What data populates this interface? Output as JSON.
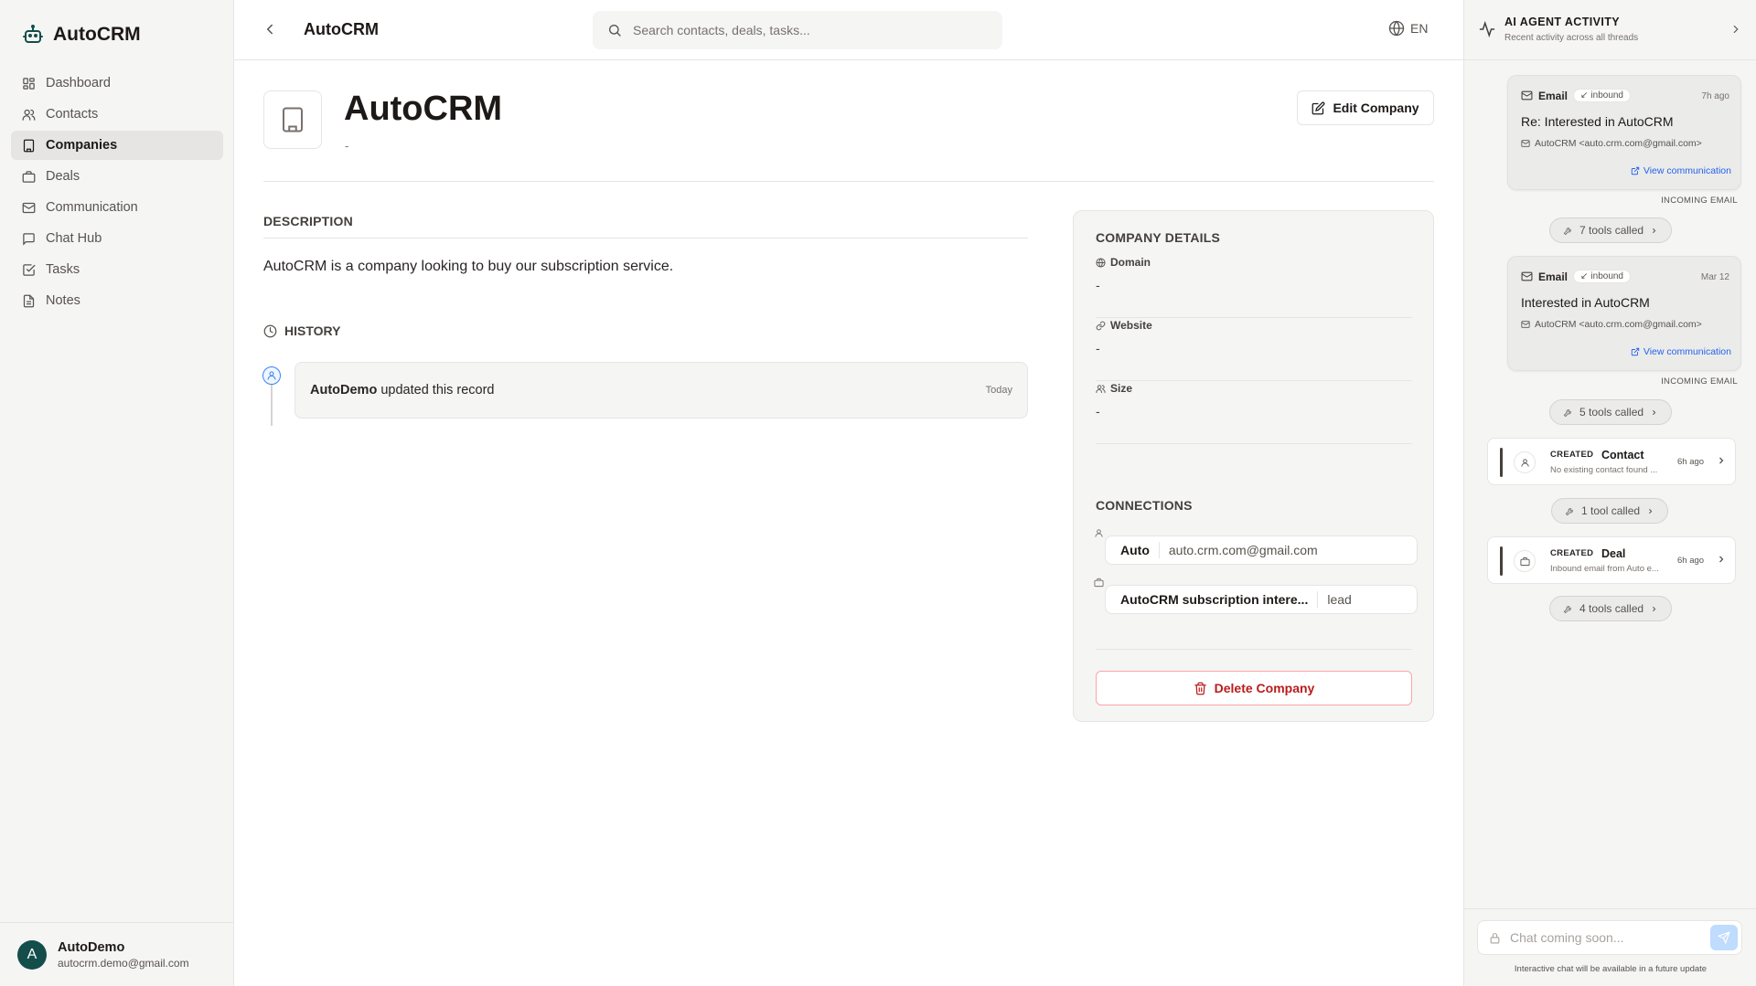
{
  "app": {
    "name": "AutoCRM"
  },
  "sidebar": {
    "items": [
      {
        "label": "Dashboard",
        "icon": "dashboard-icon"
      },
      {
        "label": "Contacts",
        "icon": "users-icon"
      },
      {
        "label": "Companies",
        "icon": "building-icon",
        "active": true
      },
      {
        "label": "Deals",
        "icon": "briefcase-icon"
      },
      {
        "label": "Communication",
        "icon": "mail-icon"
      },
      {
        "label": "Chat Hub",
        "icon": "chat-bubble-icon"
      },
      {
        "label": "Tasks",
        "icon": "checkbox-icon"
      },
      {
        "label": "Notes",
        "icon": "document-icon"
      }
    ],
    "user": {
      "initial": "A",
      "name": "AutoDemo",
      "email": "autocrm.demo@gmail.com"
    }
  },
  "topbar": {
    "title": "AutoCRM",
    "search_placeholder": "Search contacts, deals, tasks...",
    "lang": "EN"
  },
  "company": {
    "name": "AutoCRM",
    "subtitle": "-",
    "edit_label": "Edit Company"
  },
  "description": {
    "title": "DESCRIPTION",
    "text": "AutoCRM is a company looking to buy our subscription service."
  },
  "history": {
    "title": "HISTORY",
    "entries": [
      {
        "actor": "AutoDemo",
        "action": "updated this record",
        "time": "Today"
      }
    ]
  },
  "details": {
    "title": "COMPANY DETAILS",
    "fields": [
      {
        "label": "Domain",
        "value": "-",
        "icon": "globe-icon"
      },
      {
        "label": "Website",
        "value": "-",
        "icon": "link-icon"
      },
      {
        "label": "Size",
        "value": "-",
        "icon": "users-icon"
      }
    ],
    "connections_title": "CONNECTIONS",
    "connections": [
      {
        "name": "Auto",
        "meta": "auto.crm.com@gmail.com",
        "icon": "person-icon"
      },
      {
        "name": "AutoCRM subscription intere...",
        "meta": "lead",
        "icon": "briefcase-icon"
      }
    ],
    "delete_label": "Delete Company"
  },
  "agent_panel": {
    "title": "AI AGENT ACTIVITY",
    "subtitle": "Recent activity across all threads",
    "emails": [
      {
        "type": "Email",
        "direction": "inbound",
        "time": "7h ago",
        "subject": "Re: Interested in AutoCRM",
        "from": "AutoCRM <auto.crm.com@gmail.com>",
        "view": "View communication",
        "kind": "INCOMING EMAIL",
        "tools": "7 tools called"
      },
      {
        "type": "Email",
        "direction": "inbound",
        "time": "Mar 12",
        "subject": "Interested in AutoCRM",
        "from": "AutoCRM <auto.crm.com@gmail.com>",
        "view": "View communication",
        "kind": "INCOMING EMAIL",
        "tools": "5 tools called"
      }
    ],
    "created": [
      {
        "tag": "CREATED",
        "type": "Contact",
        "desc": "No existing contact found ...",
        "time": "6h ago",
        "tools": "1 tool called"
      },
      {
        "tag": "CREATED",
        "type": "Deal",
        "desc": "Inbound email from Auto e...",
        "time": "6h ago",
        "tools": "4 tools called"
      }
    ],
    "chat_placeholder": "Chat coming soon...",
    "footnote": "Interactive chat will be available in a future update"
  }
}
